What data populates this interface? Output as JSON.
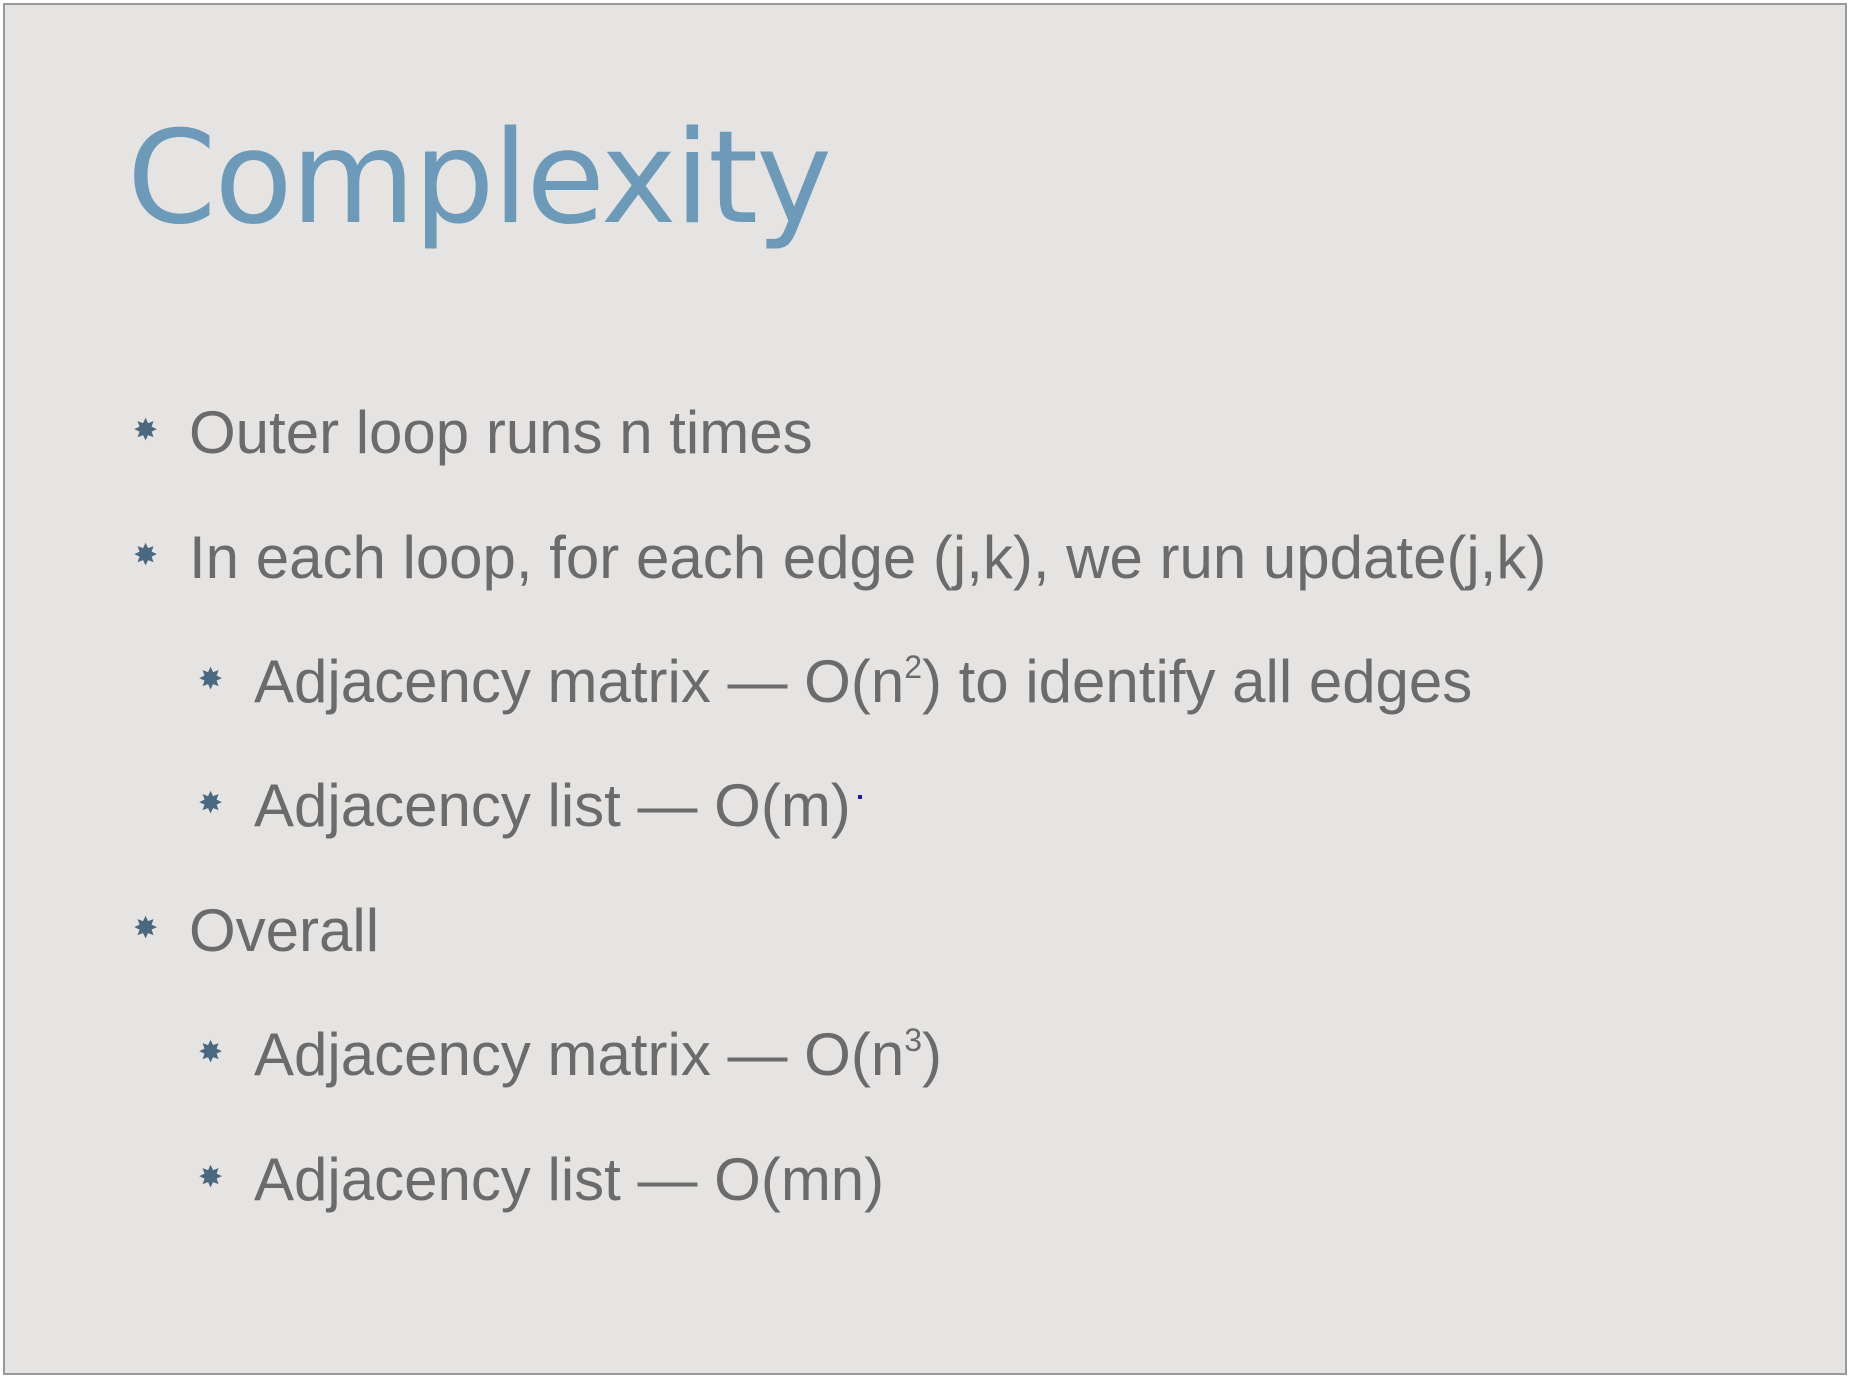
{
  "slide": {
    "title": "Complexity",
    "bullets": [
      {
        "level": 1,
        "text": "Outer loop runs n times"
      },
      {
        "level": 1,
        "text": "In each loop, for each edge (j,k), we run update(j,k)"
      },
      {
        "level": 2,
        "pre": "Adjacency matrix — O(n",
        "sup": "2",
        "post": ") to identify all edges"
      },
      {
        "level": 2,
        "text": "Adjacency list — O(m)"
      },
      {
        "level": 1,
        "text": "Overall"
      },
      {
        "level": 2,
        "pre": "Adjacency matrix — O(n",
        "sup": "3",
        "post": ")"
      },
      {
        "level": 2,
        "text": "Adjacency list — O(mn)"
      }
    ],
    "bullet_marker": "✸"
  },
  "colors": {
    "background": "#e6e4e3",
    "title": "#6d9ab8",
    "body_text": "#6b6b6b",
    "bullet_marker": "#4a6880"
  }
}
